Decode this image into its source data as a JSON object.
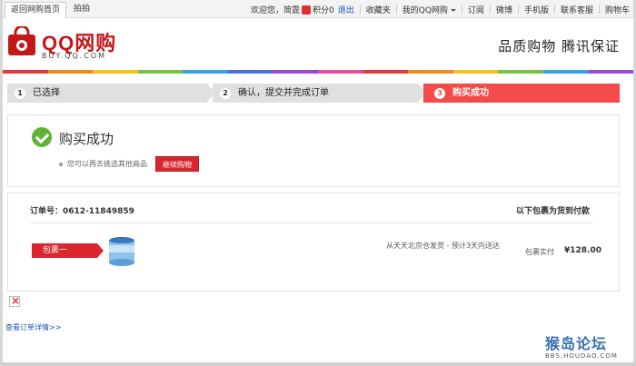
{
  "topbar": {
    "tabs": [
      "返回网购首页",
      "拍拍"
    ],
    "welcome": "欢迎您，简霆",
    "points": "积分0",
    "logout": "退出",
    "links": [
      "收藏夹",
      "我的QQ网购",
      "订阅",
      "微博",
      "手机版",
      "联系客服",
      "购物车"
    ]
  },
  "header": {
    "logo_text": "QQ网购",
    "logo_sub": "BUY.QQ.COM",
    "slogan": "品质购物 腾讯保证"
  },
  "colors": {
    "brand_red": "#d9262f",
    "step_active": "#f44a4a",
    "success_green": "#5fb336",
    "colorbar": [
      "#e23a3a",
      "#f08a1f",
      "#f5c518",
      "#7cc242",
      "#3aa0e0",
      "#4a6fd8",
      "#9a4ad0",
      "#e04fa0",
      "#e23a3a",
      "#f08a1f",
      "#f5c518",
      "#7cc242",
      "#3aa0e0",
      "#9a4ad0"
    ]
  },
  "steps": [
    {
      "num": "1",
      "label": "已选择"
    },
    {
      "num": "2",
      "label": "确认，提交并完成订单"
    },
    {
      "num": "3",
      "label": "购买成功"
    }
  ],
  "success": {
    "title": "购买成功",
    "tip": "您可以再去挑选其他商品",
    "continue_label": "继续购物"
  },
  "order": {
    "order_no": "订单号：0612-11849859",
    "cod_label": "以下包裹为货到付款",
    "package_label": "包裹一",
    "ship_info": "从天天北京仓发货 - 预计3天内送达",
    "price_label": "包裹实付",
    "price": "¥128.00"
  },
  "footer": {
    "view_order": "查看订单详情>>"
  },
  "watermark": {
    "title": "猴岛论坛",
    "sub": "BBS.HOUDAO.COM"
  }
}
